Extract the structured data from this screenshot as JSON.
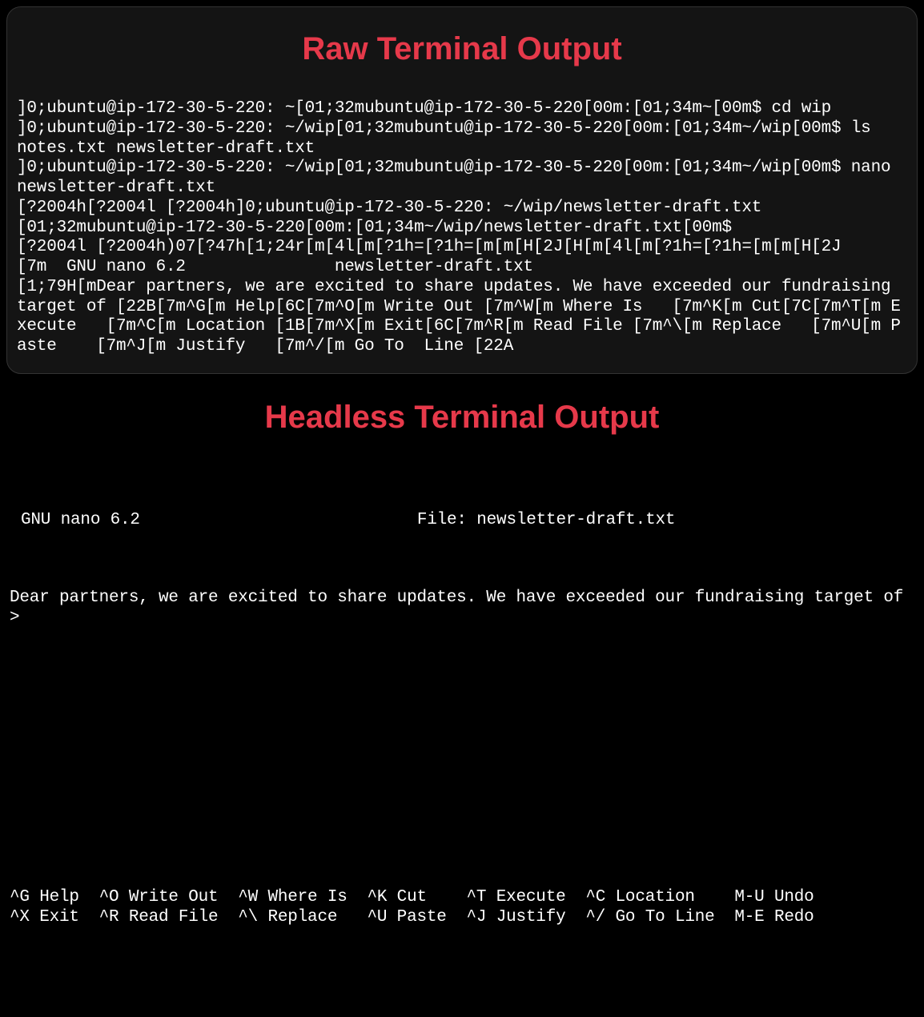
{
  "raw": {
    "title": "Raw Terminal Output",
    "content": "]0;ubuntu@ip-172-30-5-220: ~[01;32mubuntu@ip-172-30-5-220[00m:[01;34m~[00m$ cd wip\n]0;ubuntu@ip-172-30-5-220: ~/wip[01;32mubuntu@ip-172-30-5-220[00m:[01;34m~/wip[00m$ ls\nnotes.txt newsletter-draft.txt\n]0;ubuntu@ip-172-30-5-220: ~/wip[01;32mubuntu@ip-172-30-5-220[00m:[01;34m~/wip[00m$ nano newsletter-draft.txt\n[?2004h[?2004l [?2004h]0;ubuntu@ip-172-30-5-220: ~/wip/newsletter-draft.txt\n[01;32mubuntu@ip-172-30-5-220[00m:[01;34m~/wip/newsletter-draft.txt[00m$\n[?2004l [?2004h)07[?47h[1;24r[m[4l[m[?1h=[?1h=[m[m[H[2J[H[m[4l[m[?1h=[?1h=[m[m[H[2J\n[7m  GNU nano 6.2               newsletter-draft.txt\n[1;79H[mDear partners, we are excited to share updates. We have exceeded our fundraising target of [22B[7m^G[m Help[6C[7m^O[m Write Out [7m^W[m Where Is   [7m^K[m Cut[7C[7m^T[m Execute   [7m^C[m Location [1B[7m^X[m Exit[6C[7m^R[m Read File [7m^\\[m Replace   [7m^U[m Paste    [7m^J[m Justify   [7m^/[m Go To  Line [22A"
  },
  "headless": {
    "title": "Headless Terminal Output",
    "nanoVersion": "GNU nano 6.2",
    "fileLabel": "File: newsletter-draft.txt",
    "bodyText": "Dear partners, we are excited to share updates. We have exceeded our fundraising target of >",
    "shortcutsRow1": "^G Help  ^O Write Out  ^W Where Is  ^K Cut    ^T Execute  ^C Location    M-U Undo",
    "shortcutsRow2": "^X Exit  ^R Read File  ^\\ Replace   ^U Paste  ^J Justify  ^/ Go To Line  M-E Redo"
  }
}
